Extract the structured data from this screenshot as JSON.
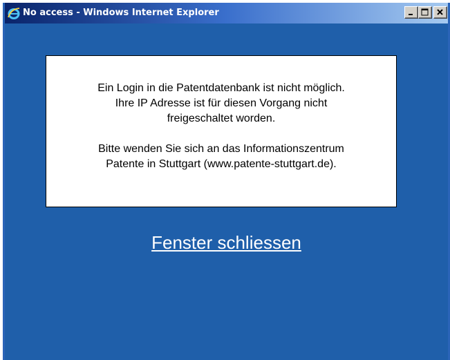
{
  "window": {
    "title": "No access - Windows Internet Explorer",
    "icon": "internet-explorer-icon",
    "controls": [
      "minimize-icon",
      "maximize-icon",
      "close-icon"
    ]
  },
  "colors": {
    "background": "#1f5faa",
    "titlebar_start": "#0a246a",
    "titlebar_end": "#a6caf0",
    "message_bg": "#ffffff",
    "link": "#ffffff"
  },
  "message": {
    "paragraph1": "Ein Login in die Patentdatenbank ist nicht möglich.\nIhre IP Adresse ist für diesen Vorgang nicht\nfreigeschaltet worden.",
    "paragraph2": "Bitte wenden Sie sich an das Informationszentrum\nPatente in Stuttgart (www.patente-stuttgart.de)."
  },
  "close_link": {
    "label": "Fenster schliessen"
  }
}
